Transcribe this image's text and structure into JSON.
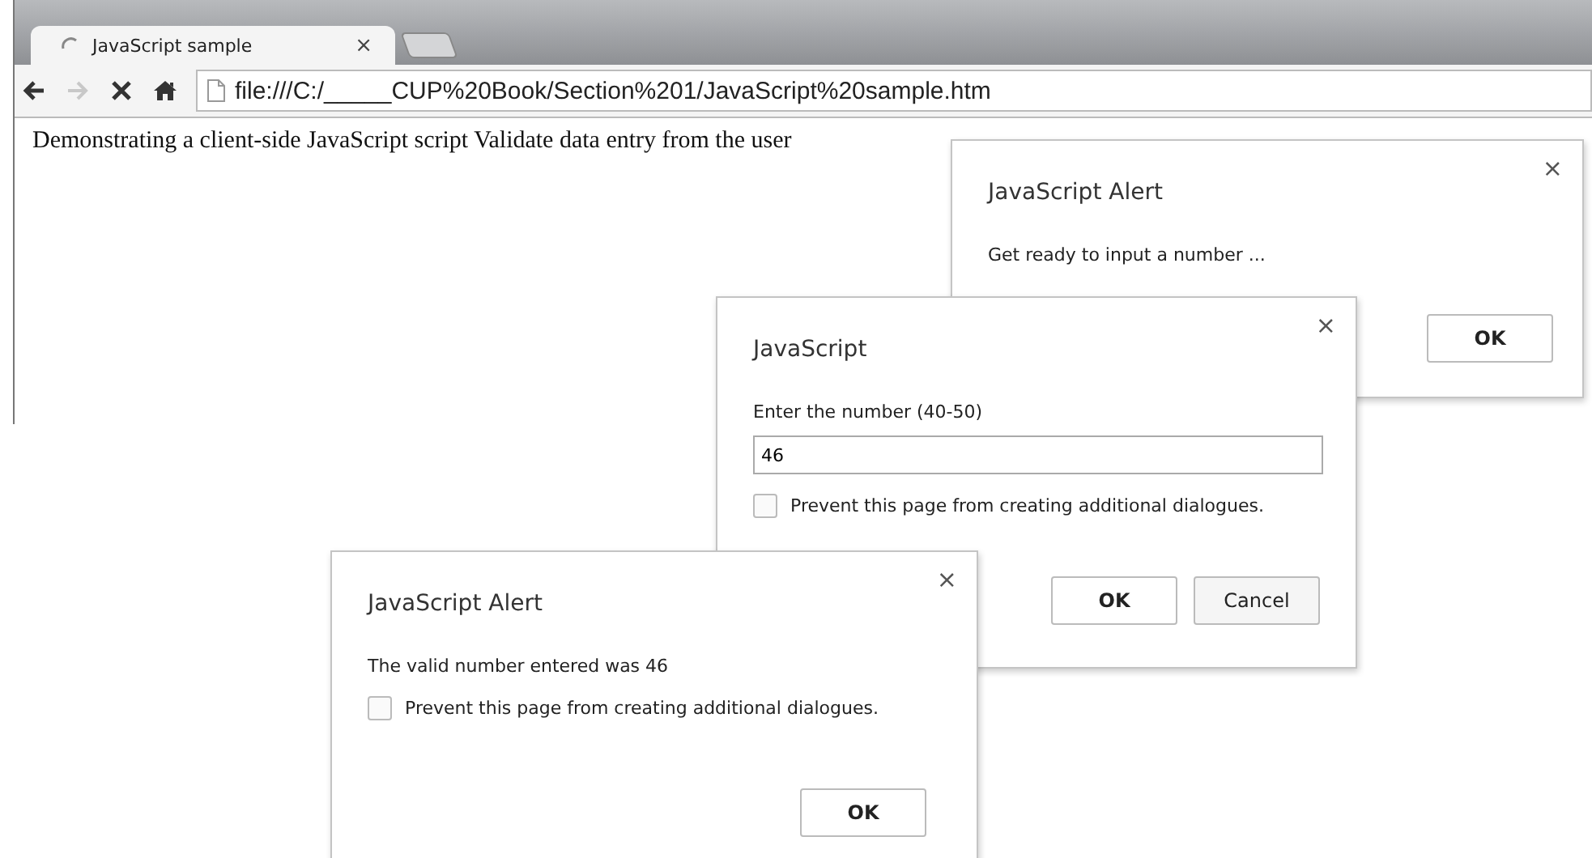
{
  "tab": {
    "title": "JavaScript sample",
    "close": "×",
    "loading": true
  },
  "nav": [
    {
      "kind": "back",
      "disabled": false
    },
    {
      "kind": "forward",
      "disabled": true
    },
    {
      "kind": "stop",
      "disabled": false
    },
    {
      "kind": "home",
      "disabled": false
    }
  ],
  "address": {
    "value": "file:///C:/_____CUP%20Book/Section%201/JavaScript%20sample.htm"
  },
  "page": {
    "text": "Demonstrating a client-side JavaScript script Validate data entry from the user"
  },
  "dialogs": [
    {
      "title": "JavaScript Alert",
      "close": "×",
      "message": "Get ready to input a number  ...",
      "buttons": [
        {
          "label": "OK",
          "kind": "default"
        }
      ]
    },
    {
      "title": "JavaScript",
      "close": "×",
      "message": "Enter the number (40-50)",
      "input": {
        "value": "46"
      },
      "checkbox": {
        "label": "Prevent this page from creating additional dialogues.",
        "checked": false
      },
      "buttons": [
        {
          "label": "OK",
          "kind": "default"
        },
        {
          "label": "Cancel",
          "kind": "normal"
        }
      ]
    },
    {
      "title": "JavaScript Alert",
      "close": "×",
      "message": "The valid number entered was 46",
      "checkbox": {
        "label": "Prevent this page from creating additional dialogues.",
        "checked": false
      },
      "buttons": [
        {
          "label": "OK",
          "kind": "default"
        }
      ]
    }
  ]
}
